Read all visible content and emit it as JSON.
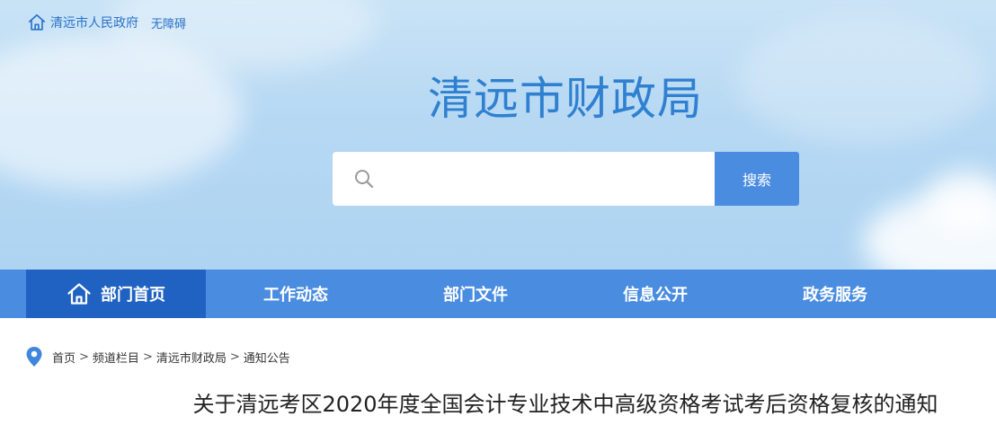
{
  "header": {
    "gov_link": "清远市人民政府",
    "accessibility_link": "无障碍",
    "site_title": "清远市财政局"
  },
  "search": {
    "value": "",
    "placeholder": "",
    "button_label": "搜索"
  },
  "nav": {
    "items": [
      {
        "label": "部门首页",
        "icon": "home-icon",
        "active": true
      },
      {
        "label": "工作动态"
      },
      {
        "label": "部门文件"
      },
      {
        "label": "信息公开"
      },
      {
        "label": "政务服务"
      }
    ]
  },
  "breadcrumb": {
    "icon": "location-pin-icon",
    "items": [
      "首页",
      "频道栏目",
      "清远市财政局",
      "通知公告"
    ],
    "separator": ">"
  },
  "article": {
    "title": "关于清远考区2020年度全国会计专业技术中高级资格考试考后资格复核的通知"
  },
  "colors": {
    "accent": "#4a8ce0",
    "active_nav": "#1f62c2",
    "title_blue": "#2f80d0",
    "link_blue": "#2a72c9"
  }
}
